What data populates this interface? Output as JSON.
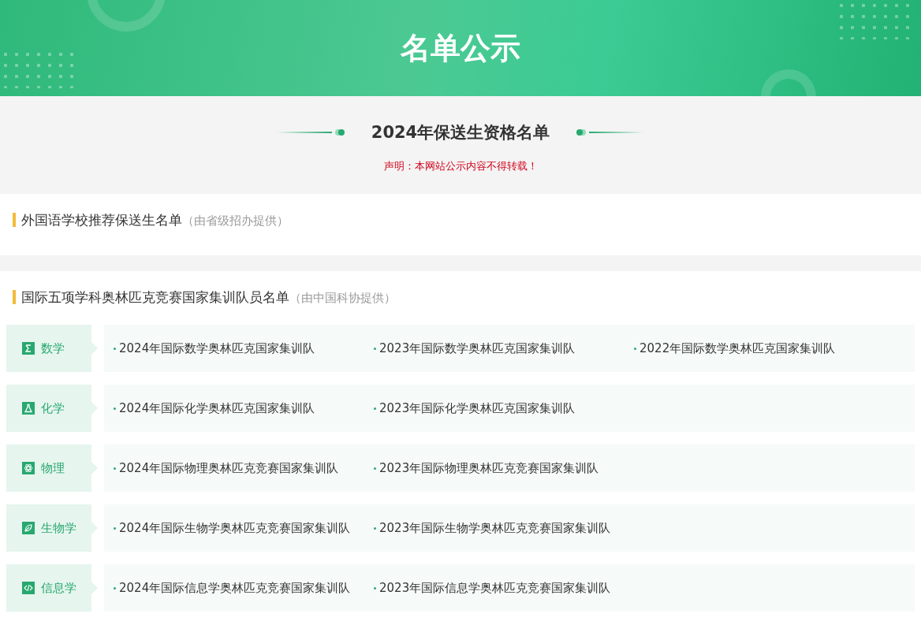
{
  "banner": {
    "title": "名单公示"
  },
  "intro": {
    "title": "2024年保送生资格名单",
    "notice": "声明：本网站公示内容不得转载！"
  },
  "sections": [
    {
      "title": "外国语学校推荐保送生名单",
      "source": "（由省级招办提供）"
    },
    {
      "title": "国际五项学科奥林匹克竞赛国家集训队员名单",
      "source": "（由中国科协提供）",
      "subjects": [
        {
          "kind": "math",
          "name": "数学",
          "links": [
            "2024年国际数学奥林匹克国家集训队",
            "2023年国际数学奥林匹克国家集训队",
            "2022年国际数学奥林匹克国家集训队"
          ]
        },
        {
          "kind": "chemistry",
          "name": "化学",
          "links": [
            "2024年国际化学奥林匹克国家集训队",
            "2023年国际化学奥林匹克国家集训队"
          ]
        },
        {
          "kind": "physics",
          "name": "物理",
          "links": [
            "2024年国际物理奥林匹克竞赛国家集训队",
            "2023年国际物理奥林匹克竞赛国家集训队"
          ]
        },
        {
          "kind": "biology",
          "name": "生物学",
          "links": [
            "2024年国际生物学奥林匹克竞赛国家集训队",
            "2023年国际生物学奥林匹克竞赛国家集训队"
          ]
        },
        {
          "kind": "informatics",
          "name": "信息学",
          "links": [
            "2024年国际信息学奥林匹克竞赛国家集训队",
            "2023年国际信息学奥林匹克竞赛国家集训队"
          ]
        }
      ]
    }
  ]
}
